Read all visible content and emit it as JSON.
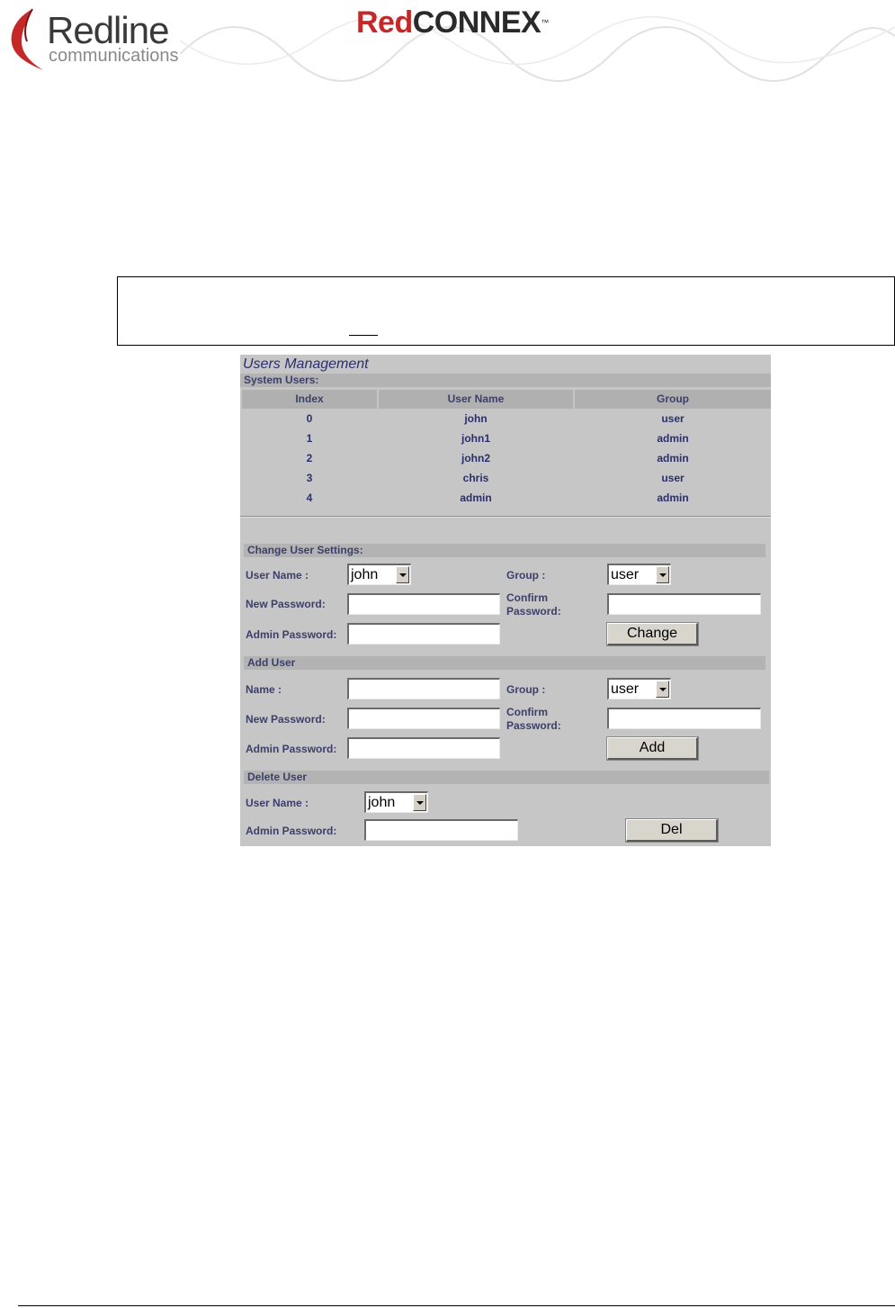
{
  "header": {
    "logo_name": "Redline",
    "logo_sub": "communications",
    "brand_red": "Red",
    "brand_dark": "CONNEX",
    "brand_tm": "™"
  },
  "panel": {
    "title": "Users Management",
    "system_users_label": "System Users:",
    "table": {
      "headers": [
        "Index",
        "User Name",
        "Group"
      ],
      "rows": [
        [
          "0",
          "john",
          "user"
        ],
        [
          "1",
          "john1",
          "admin"
        ],
        [
          "2",
          "john2",
          "admin"
        ],
        [
          "3",
          "chris",
          "user"
        ],
        [
          "4",
          "admin",
          "admin"
        ]
      ]
    },
    "change": {
      "section": "Change User Settings:",
      "user_name_label": "User Name :",
      "user_name_value": "john",
      "group_label": "Group :",
      "group_value": "user",
      "new_password_label": "New Password:",
      "confirm_label_1": "Confirm",
      "confirm_label_2": "Password:",
      "admin_password_label": "Admin Password:",
      "button": "Change"
    },
    "add": {
      "section": "Add User",
      "name_label": "Name :",
      "group_label": "Group :",
      "group_value": "user",
      "new_password_label": "New Password:",
      "confirm_label_1": "Confirm",
      "confirm_label_2": "Password:",
      "admin_password_label": "Admin Password:",
      "button": "Add"
    },
    "delete": {
      "section": "Delete User",
      "user_name_label": "User Name :",
      "user_name_value": "john",
      "admin_password_label": "Admin Password:",
      "button": "Del"
    }
  }
}
